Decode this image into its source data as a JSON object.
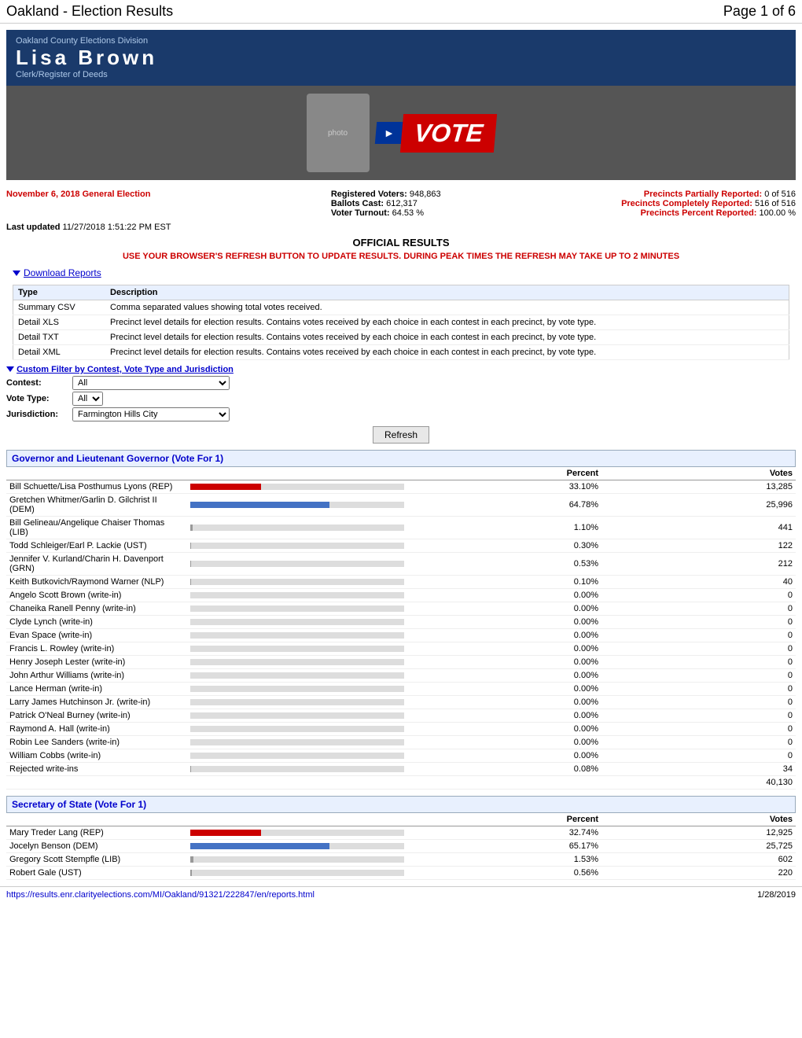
{
  "header": {
    "title": "Oakland - Election Results",
    "page_num": "Page 1 of 6"
  },
  "banner": {
    "division": "Oakland County Elections Division",
    "name": "Lisa  Brown",
    "sub": "Clerk/Register of Deeds",
    "vote_text": "VOTE"
  },
  "election_info": {
    "election": "November 6, 2018 General Election",
    "registered_voters_label": "Registered Voters:",
    "registered_voters": "948,863",
    "ballots_cast_label": "Ballots Cast:",
    "ballots_cast": "612,317",
    "voter_turnout_label": "Voter Turnout:",
    "voter_turnout": "64.53 %",
    "precincts_partial_label": "Precincts Partially Reported:",
    "precincts_partial": "0 of 516",
    "precincts_complete_label": "Precincts Completely Reported:",
    "precincts_complete": "516 of 516",
    "precincts_pct_label": "Precincts Percent Reported:",
    "precincts_pct": "100.00 %",
    "last_updated_label": "Last updated",
    "last_updated": "11/27/2018 1:51:22 PM EST"
  },
  "notices": {
    "official": "OFFICIAL RESULTS",
    "refresh": "USE YOUR BROWSER'S REFRESH BUTTON TO UPDATE RESULTS. DURING PEAK TIMES THE REFRESH MAY TAKE UP TO 2 MINUTES"
  },
  "download": {
    "link_text": "Download Reports",
    "col_type": "Type",
    "col_desc": "Description",
    "rows": [
      {
        "type": "Summary CSV",
        "desc": "Comma separated values showing total votes received."
      },
      {
        "type": "Detail XLS",
        "desc": "Precinct level details for election results. Contains votes received by each choice in each contest in each precinct, by vote type."
      },
      {
        "type": "Detail TXT",
        "desc": "Precinct level details for election results. Contains votes received by each choice in each contest in each precinct, by vote type."
      },
      {
        "type": "Detail XML",
        "desc": "Precinct level details for election results. Contains votes received by each choice in each contest in each precinct, by vote type."
      }
    ]
  },
  "filter": {
    "link_text": "Custom Filter by Contest, Vote Type and Jurisdiction",
    "contest_label": "Contest:",
    "contest_value": "All",
    "vote_type_label": "Vote Type:",
    "vote_type_value": "All",
    "jurisdiction_label": "Jurisdiction:",
    "jurisdiction_value": "Farmington Hills City",
    "refresh_btn": "Refresh"
  },
  "governor_section": {
    "title": "Governor and Lieutenant Governor (Vote For 1)",
    "col_pct": "Percent",
    "col_votes": "Votes",
    "candidates": [
      {
        "name": "Bill Schuette/Lisa Posthumus Lyons (REP)",
        "pct": "33.10%",
        "votes": "13,285",
        "bar_pct": 33,
        "bar_type": "red"
      },
      {
        "name": "Gretchen Whitmer/Garlin D. Gilchrist II (DEM)",
        "pct": "64.78%",
        "votes": "25,996",
        "bar_pct": 65,
        "bar_type": "blue"
      },
      {
        "name": "Bill Gelineau/Angelique Chaiser Thomas (LIB)",
        "pct": "1.10%",
        "votes": "441",
        "bar_pct": 1,
        "bar_type": "gray"
      },
      {
        "name": "Todd Schleiger/Earl P. Lackie (UST)",
        "pct": "0.30%",
        "votes": "122",
        "bar_pct": 0.3,
        "bar_type": "gray"
      },
      {
        "name": "Jennifer V. Kurland/Charin H. Davenport (GRN)",
        "pct": "0.53%",
        "votes": "212",
        "bar_pct": 0.5,
        "bar_type": "gray"
      },
      {
        "name": "Keith Butkovich/Raymond Warner (NLP)",
        "pct": "0.10%",
        "votes": "40",
        "bar_pct": 0.1,
        "bar_type": "gray"
      },
      {
        "name": "Angelo Scott Brown (write-in)",
        "pct": "0.00%",
        "votes": "0",
        "bar_pct": 0,
        "bar_type": "gray"
      },
      {
        "name": "Chaneika Ranell Penny (write-in)",
        "pct": "0.00%",
        "votes": "0",
        "bar_pct": 0,
        "bar_type": "gray"
      },
      {
        "name": "Clyde Lynch (write-in)",
        "pct": "0.00%",
        "votes": "0",
        "bar_pct": 0,
        "bar_type": "gray"
      },
      {
        "name": "Evan Space (write-in)",
        "pct": "0.00%",
        "votes": "0",
        "bar_pct": 0,
        "bar_type": "gray"
      },
      {
        "name": "Francis L. Rowley (write-in)",
        "pct": "0.00%",
        "votes": "0",
        "bar_pct": 0,
        "bar_type": "gray"
      },
      {
        "name": "Henry Joseph Lester (write-in)",
        "pct": "0.00%",
        "votes": "0",
        "bar_pct": 0,
        "bar_type": "gray"
      },
      {
        "name": "John Arthur Williams (write-in)",
        "pct": "0.00%",
        "votes": "0",
        "bar_pct": 0,
        "bar_type": "gray"
      },
      {
        "name": "Lance Herman (write-in)",
        "pct": "0.00%",
        "votes": "0",
        "bar_pct": 0,
        "bar_type": "gray"
      },
      {
        "name": "Larry James Hutchinson Jr. (write-in)",
        "pct": "0.00%",
        "votes": "0",
        "bar_pct": 0,
        "bar_type": "gray"
      },
      {
        "name": "Patrick O'Neal Burney (write-in)",
        "pct": "0.00%",
        "votes": "0",
        "bar_pct": 0,
        "bar_type": "gray"
      },
      {
        "name": "Raymond A. Hall (write-in)",
        "pct": "0.00%",
        "votes": "0",
        "bar_pct": 0,
        "bar_type": "gray"
      },
      {
        "name": "Robin Lee Sanders (write-in)",
        "pct": "0.00%",
        "votes": "0",
        "bar_pct": 0,
        "bar_type": "gray"
      },
      {
        "name": "William Cobbs (write-in)",
        "pct": "0.00%",
        "votes": "0",
        "bar_pct": 0,
        "bar_type": "gray"
      },
      {
        "name": "Rejected write-ins",
        "pct": "0.08%",
        "votes": "34",
        "bar_pct": 0.1,
        "bar_type": "gray"
      }
    ],
    "total": "40,130"
  },
  "secretary_section": {
    "title": "Secretary of State (Vote For 1)",
    "col_pct": "Percent",
    "col_votes": "Votes",
    "candidates": [
      {
        "name": "Mary Treder Lang (REP)",
        "pct": "32.74%",
        "votes": "12,925",
        "bar_pct": 33,
        "bar_type": "red"
      },
      {
        "name": "Jocelyn Benson (DEM)",
        "pct": "65.17%",
        "votes": "25,725",
        "bar_pct": 65,
        "bar_type": "blue"
      },
      {
        "name": "Gregory Scott Stempfle (LIB)",
        "pct": "1.53%",
        "votes": "602",
        "bar_pct": 1.5,
        "bar_type": "gray"
      },
      {
        "name": "Robert Gale (UST)",
        "pct": "0.56%",
        "votes": "220",
        "bar_pct": 0.6,
        "bar_type": "gray"
      }
    ]
  },
  "footer": {
    "url": "https://results.enr.clarityelections.com/MI/Oakland/91321/222847/en/reports.html",
    "date": "1/28/2019"
  }
}
